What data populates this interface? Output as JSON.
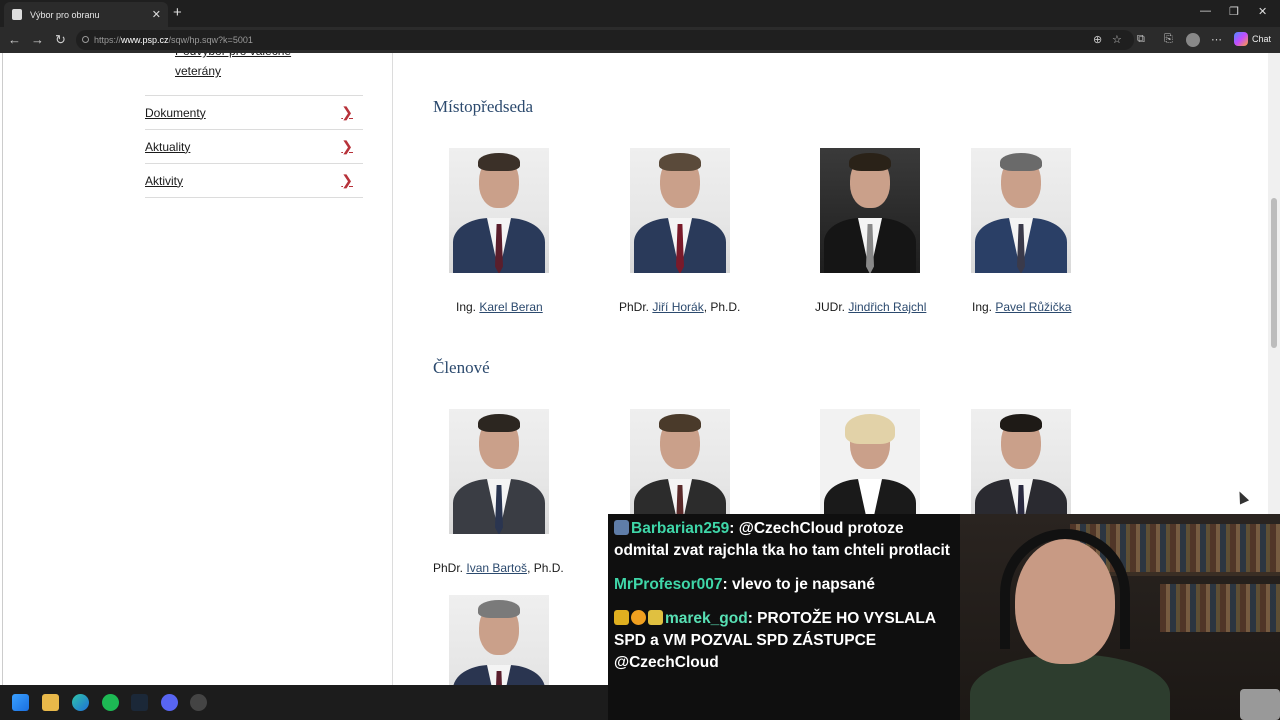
{
  "browser": {
    "tab_title": "Výbor pro obranu",
    "url_prefix": "https://",
    "url_host": "www.psp.cz",
    "url_path": "/sqw/hp.sqw?k=5001",
    "chat_label": "Chat"
  },
  "sidebar": {
    "sub_link_line1": "Podvýbor pro válečné",
    "sub_link_line2": "veterány",
    "items": [
      {
        "label": "Dokumenty"
      },
      {
        "label": "Aktuality"
      },
      {
        "label": "Aktivity"
      }
    ]
  },
  "sections": {
    "vice": {
      "title": "Místopředseda",
      "people": [
        {
          "prefix": "Ing.",
          "name": "Karel Beran",
          "suffix": ""
        },
        {
          "prefix": "PhDr.",
          "name": "Jiří Horák",
          "suffix": ", Ph.D."
        },
        {
          "prefix": "JUDr.",
          "name": "Jindřich Rajchl",
          "suffix": ""
        },
        {
          "prefix": "Ing.",
          "name": "Pavel Růžička",
          "suffix": ""
        }
      ]
    },
    "members": {
      "title": "Členové",
      "people": [
        {
          "prefix": "PhDr.",
          "name": "Ivan Bartoš",
          "suffix": ", Ph.D."
        }
      ]
    }
  },
  "chat": {
    "messages": [
      {
        "user": "Barbarian259",
        "text": "@CzechCloud protoze odmital zvat rajchla tka ho tam chteli protlacit"
      },
      {
        "user": "MrProfesor007",
        "text": "vlevo to je napsané"
      },
      {
        "user": "marek_god",
        "text": "PROTOŽE HO VYSLALA SPD a VM POZVAL SPD ZÁSTUPCE @CzechCloud"
      }
    ]
  }
}
